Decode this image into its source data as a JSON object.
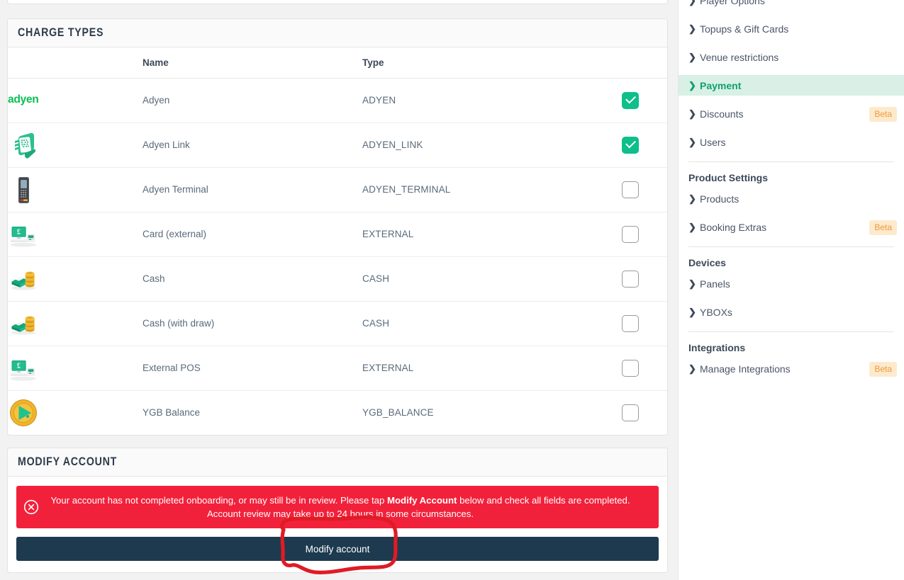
{
  "charge_types_card": {
    "title": "CHARGE TYPES",
    "columns": [
      "",
      "Name",
      "Type",
      ""
    ],
    "rows": [
      {
        "icon": "adyen-logo-icon",
        "name": "Adyen",
        "type": "ADYEN",
        "enabled": true
      },
      {
        "icon": "phone-qr-hand-icon",
        "name": "Adyen Link",
        "type": "ADYEN_LINK",
        "enabled": true
      },
      {
        "icon": "card-terminal-icon",
        "name": "Adyen Terminal",
        "type": "ADYEN_TERMINAL",
        "enabled": false
      },
      {
        "icon": "pos-monitor-pound-icon",
        "name": "Card (external)",
        "type": "EXTERNAL",
        "enabled": false
      },
      {
        "icon": "cash-notes-coins-icon",
        "name": "Cash",
        "type": "CASH",
        "enabled": false
      },
      {
        "icon": "cash-notes-coins-icon",
        "name": "Cash (with draw)",
        "type": "CASH",
        "enabled": false
      },
      {
        "icon": "pos-monitor-pound-icon",
        "name": "External POS",
        "type": "EXTERNAL",
        "enabled": false
      },
      {
        "icon": "gold-coin-play-icon",
        "name": "YGB Balance",
        "type": "YGB_BALANCE",
        "enabled": false
      }
    ]
  },
  "modify_account_card": {
    "title": "MODIFY ACCOUNT",
    "alert": {
      "icon": "error-circle-x-icon",
      "text_part_1": "Your account has not completed onboarding, or may still be in review. Please tap ",
      "text_bold": "Modify Account",
      "text_part_2": " below and check all fields are completed. Account review may take up to 24 hours in some circumstances.",
      "background_color": "#f2213b"
    },
    "button_label": "Modify account",
    "button_color": "#1d3a4f"
  },
  "sidebar": {
    "items": [
      {
        "label": "Player Options",
        "badge": "",
        "active": false,
        "group": "",
        "partial": true
      },
      {
        "label": "Topups & Gift Cards",
        "badge": "",
        "active": false,
        "group": ""
      },
      {
        "label": "Venue restrictions",
        "badge": "",
        "active": false,
        "group": ""
      },
      {
        "label": "Payment",
        "badge": "",
        "active": true,
        "group": ""
      },
      {
        "label": "Discounts",
        "badge": "Beta",
        "active": false,
        "group": ""
      },
      {
        "label": "Users",
        "badge": "",
        "active": false,
        "group": ""
      }
    ],
    "groups": [
      {
        "title": "Product Settings",
        "items": [
          {
            "label": "Products",
            "badge": ""
          },
          {
            "label": "Booking Extras",
            "badge": "Beta"
          }
        ]
      },
      {
        "title": "Devices",
        "items": [
          {
            "label": "Panels",
            "badge": ""
          },
          {
            "label": "YBOXs",
            "badge": ""
          }
        ]
      },
      {
        "title": "Integrations",
        "items": [
          {
            "label": "Manage Integrations",
            "badge": "Beta"
          }
        ]
      }
    ],
    "chevron_glyph": "❯",
    "active_background": "#d8f0e6",
    "active_text_color": "#0f9f72",
    "badge_background": "#fdeacd",
    "badge_text_color": "#f0993a"
  },
  "annotation": {
    "shape": "hand-drawn-circle",
    "color": "#e01b24",
    "target": "Modify account button"
  }
}
